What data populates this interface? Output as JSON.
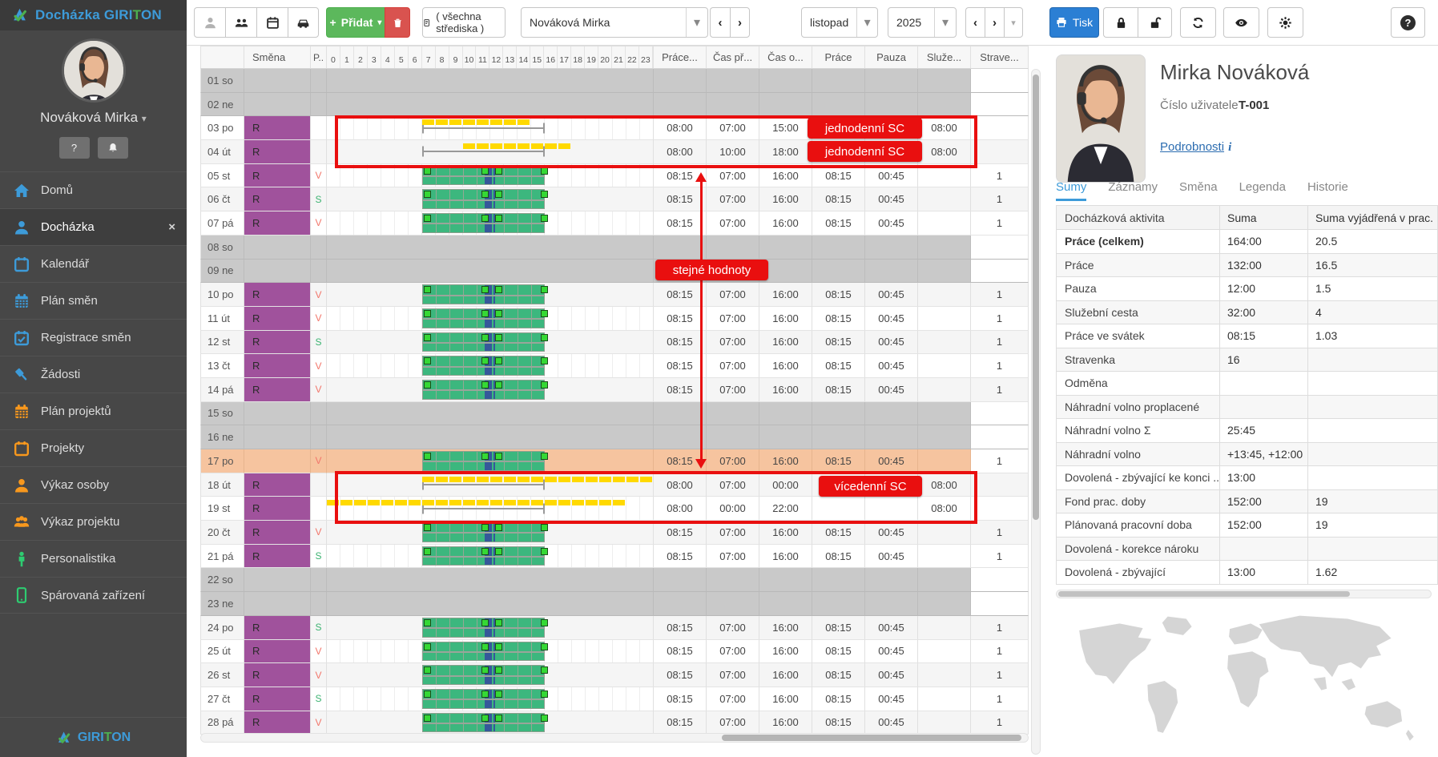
{
  "logo": {
    "product": "Docházka",
    "brand_a": "GIRI",
    "brand_b": "T",
    "brand_c": "ON"
  },
  "sidebar": {
    "user_name": "Nováková Mirka",
    "help_badge": "?",
    "items": [
      {
        "icon": "home-icon",
        "label": "Domů",
        "color": "#3d9bd9",
        "active": false
      },
      {
        "icon": "user-icon",
        "label": "Docházka",
        "color": "#3d9bd9",
        "active": true
      },
      {
        "icon": "calendar-icon",
        "label": "Kalendář",
        "color": "#3d9bd9",
        "active": false
      },
      {
        "icon": "calendar-grid-icon",
        "label": "Plán směn",
        "color": "#3d9bd9",
        "active": false
      },
      {
        "icon": "calendar-check-icon",
        "label": "Registrace směn",
        "color": "#3d9bd9",
        "active": false
      },
      {
        "icon": "gavel-icon",
        "label": "Žádosti",
        "color": "#3d9bd9",
        "active": false
      },
      {
        "icon": "calendar-grid-icon",
        "label": "Plán projektů",
        "color": "#f8981d",
        "active": false
      },
      {
        "icon": "calendar-icon",
        "label": "Projekty",
        "color": "#f8981d",
        "active": false
      },
      {
        "icon": "user-icon",
        "label": "Výkaz osoby",
        "color": "#f8981d",
        "active": false
      },
      {
        "icon": "users-icon",
        "label": "Výkaz projektu",
        "color": "#f8981d",
        "active": false
      },
      {
        "icon": "person-icon",
        "label": "Personalistika",
        "color": "#2ecc71",
        "active": false
      },
      {
        "icon": "mobile-icon",
        "label": "Spárovaná zařízení",
        "color": "#2ecc71",
        "active": false
      }
    ]
  },
  "topbar": {
    "add_label": "Přidat",
    "stredisko_label": "( všechna střediska )",
    "person_value": "Nováková Mirka",
    "month_value": "listopad",
    "year_value": "2025",
    "print_label": "Tisk"
  },
  "table": {
    "headers": {
      "day": "",
      "smena": "Směna",
      "p": "P..",
      "prace_sum": "Práce...",
      "cas_pr": "Čas př...",
      "cas_od": "Čas o...",
      "prace": "Práce",
      "pauza": "Pauza",
      "sluz": "Služe...",
      "strav": "Strave..."
    },
    "hours": [
      0,
      1,
      2,
      3,
      4,
      5,
      6,
      7,
      8,
      9,
      10,
      11,
      12,
      13,
      14,
      15,
      16,
      17,
      18,
      19,
      20,
      21,
      22,
      23
    ],
    "gantt_defaults": {
      "work": [
        7,
        16
      ],
      "pause": [
        11.55,
        12.05
      ],
      "pause2": [
        12.18,
        12.3
      ],
      "markers": [
        7.05,
        11.3,
        12.32,
        15.62
      ]
    },
    "rows": [
      {
        "day": "01 so",
        "kind": "weekend"
      },
      {
        "day": "02 ne",
        "kind": "weekend"
      },
      {
        "day": "03 po",
        "shift": "R",
        "gantt": "plan",
        "bar": [
          7,
          15
        ],
        "vals": [
          "08:00",
          "07:00",
          "15:00",
          "",
          "",
          "08:00",
          ""
        ]
      },
      {
        "day": "04 út",
        "shift": "R",
        "gantt": "plan",
        "bar": [
          10,
          18
        ],
        "vals": [
          "08:00",
          "10:00",
          "18:00",
          "",
          "",
          "08:00",
          ""
        ]
      },
      {
        "day": "05 st",
        "shift": "R",
        "p": "V",
        "gantt": "green",
        "vals": [
          "08:15",
          "07:00",
          "16:00",
          "08:15",
          "00:45",
          "",
          "1"
        ]
      },
      {
        "day": "06 čt",
        "shift": "R",
        "p": "S",
        "gantt": "green",
        "vals": [
          "08:15",
          "07:00",
          "16:00",
          "08:15",
          "00:45",
          "",
          "1"
        ]
      },
      {
        "day": "07 pá",
        "shift": "R",
        "p": "V",
        "gantt": "green",
        "vals": [
          "08:15",
          "07:00",
          "16:00",
          "08:15",
          "00:45",
          "",
          "1"
        ]
      },
      {
        "day": "08 so",
        "kind": "weekend"
      },
      {
        "day": "09 ne",
        "kind": "weekend"
      },
      {
        "day": "10 po",
        "shift": "R",
        "p": "V",
        "gantt": "green",
        "vals": [
          "08:15",
          "07:00",
          "16:00",
          "08:15",
          "00:45",
          "",
          "1"
        ]
      },
      {
        "day": "11 út",
        "shift": "R",
        "p": "V",
        "gantt": "green",
        "vals": [
          "08:15",
          "07:00",
          "16:00",
          "08:15",
          "00:45",
          "",
          "1"
        ]
      },
      {
        "day": "12 st",
        "shift": "R",
        "p": "S",
        "gantt": "green",
        "vals": [
          "08:15",
          "07:00",
          "16:00",
          "08:15",
          "00:45",
          "",
          "1"
        ]
      },
      {
        "day": "13 čt",
        "shift": "R",
        "p": "V",
        "gantt": "green",
        "vals": [
          "08:15",
          "07:00",
          "16:00",
          "08:15",
          "00:45",
          "",
          "1"
        ]
      },
      {
        "day": "14 pá",
        "shift": "R",
        "p": "V",
        "gantt": "green",
        "vals": [
          "08:15",
          "07:00",
          "16:00",
          "08:15",
          "00:45",
          "",
          "1"
        ]
      },
      {
        "day": "15 so",
        "kind": "weekend"
      },
      {
        "day": "16 ne",
        "kind": "weekend"
      },
      {
        "day": "17 po",
        "kind": "holiday",
        "p": "V",
        "gantt": "green",
        "vals": [
          "08:15",
          "07:00",
          "16:00",
          "08:15",
          "00:45",
          "",
          "1"
        ]
      },
      {
        "day": "18 út",
        "shift": "R",
        "gantt": "plan",
        "bar": [
          7,
          24
        ],
        "vals": [
          "08:00",
          "07:00",
          "00:00",
          "",
          "",
          "08:00",
          ""
        ]
      },
      {
        "day": "19 st",
        "shift": "R",
        "gantt": "plan",
        "bar": [
          0,
          22
        ],
        "vals": [
          "08:00",
          "00:00",
          "22:00",
          "",
          "",
          "08:00",
          ""
        ]
      },
      {
        "day": "20 čt",
        "shift": "R",
        "p": "V",
        "gantt": "green",
        "vals": [
          "08:15",
          "07:00",
          "16:00",
          "08:15",
          "00:45",
          "",
          "1"
        ]
      },
      {
        "day": "21 pá",
        "shift": "R",
        "p": "S",
        "gantt": "green",
        "vals": [
          "08:15",
          "07:00",
          "16:00",
          "08:15",
          "00:45",
          "",
          "1"
        ]
      },
      {
        "day": "22 so",
        "kind": "weekend"
      },
      {
        "day": "23 ne",
        "kind": "weekend"
      },
      {
        "day": "24 po",
        "shift": "R",
        "p": "S",
        "gantt": "green",
        "vals": [
          "08:15",
          "07:00",
          "16:00",
          "08:15",
          "00:45",
          "",
          "1"
        ]
      },
      {
        "day": "25 út",
        "shift": "R",
        "p": "V",
        "gantt": "green",
        "vals": [
          "08:15",
          "07:00",
          "16:00",
          "08:15",
          "00:45",
          "",
          "1"
        ]
      },
      {
        "day": "26 st",
        "shift": "R",
        "p": "V",
        "gantt": "green",
        "vals": [
          "08:15",
          "07:00",
          "16:00",
          "08:15",
          "00:45",
          "",
          "1"
        ]
      },
      {
        "day": "27 čt",
        "shift": "R",
        "p": "S",
        "gantt": "green",
        "vals": [
          "08:15",
          "07:00",
          "16:00",
          "08:15",
          "00:45",
          "",
          "1"
        ]
      },
      {
        "day": "28 pá",
        "shift": "R",
        "p": "V",
        "gantt": "green",
        "vals": [
          "08:15",
          "07:00",
          "16:00",
          "08:15",
          "00:45",
          "",
          "1"
        ]
      }
    ]
  },
  "annotations": {
    "one_day": "jednodenní SC",
    "same_values": "stejné hodnoty",
    "multi_day": "vícedenní SC",
    "red": "#e90f0f"
  },
  "panel": {
    "name": "Mirka Nováková",
    "user_no_label": "Číslo uživatele",
    "user_no": "T-001",
    "details_label": "Podrobnosti",
    "details_icon": "i",
    "tabs": [
      {
        "label": "Sumy",
        "active": true
      },
      {
        "label": "Záznamy",
        "active": false
      },
      {
        "label": "Směna",
        "active": false
      },
      {
        "label": "Legenda",
        "active": false
      },
      {
        "label": "Historie",
        "active": false
      }
    ],
    "sums": {
      "headers": [
        "Docházková aktivita",
        "Suma",
        "Suma vyjádřená v prac."
      ],
      "rows": [
        {
          "label": "Práce (celkem)",
          "suma": "164:00",
          "prac": "20.5",
          "bold": true
        },
        {
          "label": "Práce",
          "suma": "132:00",
          "prac": "16.5"
        },
        {
          "label": "Pauza",
          "suma": "12:00",
          "prac": "1.5"
        },
        {
          "label": "Služební cesta",
          "suma": "32:00",
          "prac": "4"
        },
        {
          "label": "Práce ve svátek",
          "suma": "08:15",
          "prac": "1.03"
        },
        {
          "label": "Stravenka",
          "suma": "16",
          "prac": ""
        },
        {
          "label": "Odměna",
          "suma": "",
          "prac": ""
        },
        {
          "label": "Náhradní volno proplacené",
          "suma": "",
          "prac": ""
        },
        {
          "label": "Náhradní volno Σ",
          "suma": "25:45",
          "prac": ""
        },
        {
          "label": "Náhradní volno",
          "suma": "+13:45, +12:00",
          "prac": ""
        },
        {
          "label": "Dovolená - zbývající ke konci ...",
          "suma": "13:00",
          "prac": ""
        },
        {
          "label": "Fond prac. doby",
          "suma": "152:00",
          "prac": "19"
        },
        {
          "label": "Plánovaná pracovní doba",
          "suma": "152:00",
          "prac": "19"
        },
        {
          "label": "Dovolená - korekce nároku",
          "suma": "",
          "prac": ""
        },
        {
          "label": "Dovolená - zbývající",
          "suma": "13:00",
          "prac": "1.62"
        }
      ]
    }
  },
  "colors": {
    "accent_blue": "#3d9bd9",
    "accent_orange": "#f8981d",
    "accent_green": "#2ecc71",
    "shift_purple": "#a0529c",
    "weekend_gray": "#c9c9c9",
    "holiday_orange": "#f6c49f",
    "gantt_green": "#3cb77e",
    "gantt_pause_blue": "#35589a",
    "gantt_yellow": "#ffd900",
    "annotation_red": "#e90f0f",
    "btn_add_green": "#5cb85c",
    "btn_del_red": "#d9534f",
    "btn_print_blue": "#2b7fd4"
  }
}
